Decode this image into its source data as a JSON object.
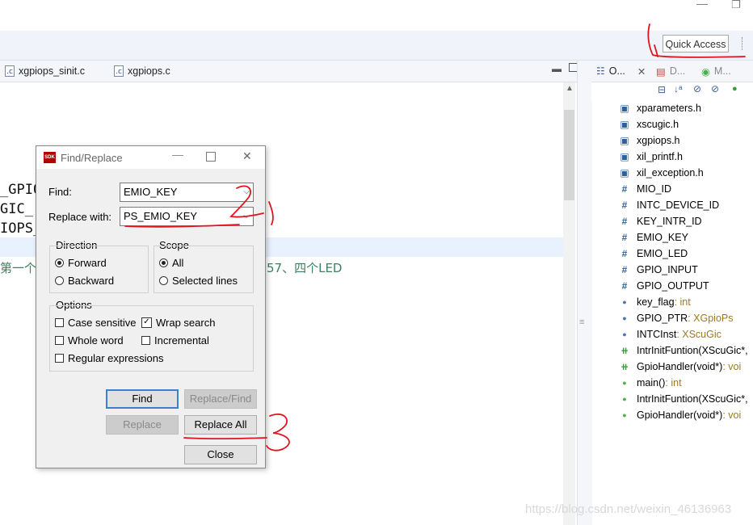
{
  "window": {
    "restore_glyph": "❐",
    "minimize_glyph": "—"
  },
  "toolbar": {
    "quick_access": "Quick Access"
  },
  "editor_tabs": [
    {
      "label": "xgpiops_sinit.c",
      "icon": "c-file-icon"
    },
    {
      "label": "xgpiops.c",
      "icon": "c-file-icon"
    }
  ],
  "editor": {
    "lines": [
      "_GPIO",
      "GIC_",
      "IOPS_"
    ],
    "comment_left": "第一个",
    "comment_right": "57、四个LED"
  },
  "outline_tabs": [
    {
      "label": "O...",
      "icon": "outline-icon"
    },
    {
      "label": "D...",
      "icon": "doc-icon"
    },
    {
      "label": "M...",
      "icon": "make-icon"
    }
  ],
  "outline": {
    "items": [
      {
        "name": "xparameters.h",
        "kind": "include",
        "type": ""
      },
      {
        "name": "xscugic.h",
        "kind": "include",
        "type": ""
      },
      {
        "name": "xgpiops.h",
        "kind": "include",
        "type": ""
      },
      {
        "name": "xil_printf.h",
        "kind": "include",
        "type": ""
      },
      {
        "name": "xil_exception.h",
        "kind": "include",
        "type": ""
      },
      {
        "name": "MIO_ID",
        "kind": "macro",
        "type": ""
      },
      {
        "name": "INTC_DEVICE_ID",
        "kind": "macro",
        "type": ""
      },
      {
        "name": "KEY_INTR_ID",
        "kind": "macro",
        "type": ""
      },
      {
        "name": "EMIO_KEY",
        "kind": "macro",
        "type": ""
      },
      {
        "name": "EMIO_LED",
        "kind": "macro",
        "type": ""
      },
      {
        "name": "GPIO_INPUT",
        "kind": "macro",
        "type": ""
      },
      {
        "name": "GPIO_OUTPUT",
        "kind": "macro",
        "type": ""
      },
      {
        "name": "key_flag",
        "kind": "variable",
        "type": " : int"
      },
      {
        "name": "GPIO_PTR",
        "kind": "variable",
        "type": " : XGpioPs"
      },
      {
        "name": "INTCInst",
        "kind": "variable",
        "type": " : XScuGic"
      },
      {
        "name": "IntrInitFuntion(XScuGic*,",
        "kind": "declaration",
        "type": ""
      },
      {
        "name": "GpioHandler(void*)",
        "kind": "declaration",
        "type": " : voi"
      },
      {
        "name": "main()",
        "kind": "function",
        "type": " : int"
      },
      {
        "name": "IntrInitFuntion(XScuGic*,",
        "kind": "function",
        "type": ""
      },
      {
        "name": "GpioHandler(void*)",
        "kind": "function",
        "type": " : voi"
      }
    ]
  },
  "dialog": {
    "title": "Find/Replace",
    "app_icon_text": "SDK",
    "find_label": "Find:",
    "find_value": "EMIO_KEY",
    "replace_label": "Replace with:",
    "replace_value": "PS_EMIO_KEY",
    "direction": {
      "label": "Direction",
      "options": [
        "Forward",
        "Backward"
      ],
      "selected": "Forward"
    },
    "scope": {
      "label": "Scope",
      "options": [
        "All",
        "Selected lines"
      ],
      "selected": "All"
    },
    "options": {
      "label": "Options",
      "case_sensitive": "Case sensitive",
      "wrap_search": "Wrap search",
      "whole_word": "Whole word",
      "incremental": "Incremental",
      "regex": "Regular expressions"
    },
    "buttons": {
      "find": "Find",
      "replace_find": "Replace/Find",
      "replace": "Replace",
      "replace_all": "Replace All",
      "close": "Close"
    }
  },
  "watermark": "https://blog.csdn.net/weixin_46136963",
  "annotation_color": "#e0141e"
}
